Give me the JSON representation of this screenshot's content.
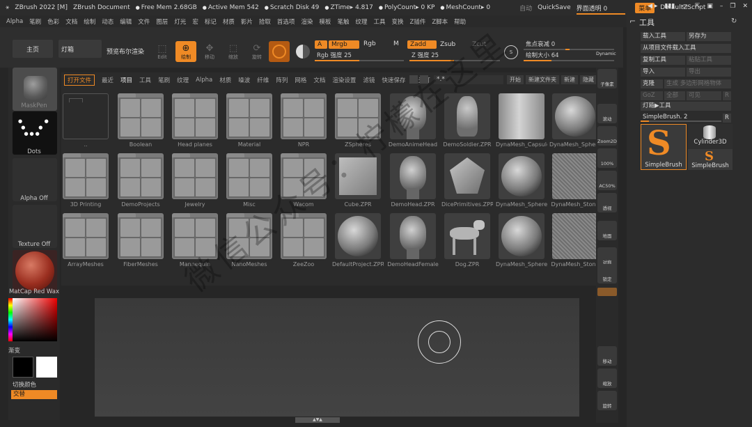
{
  "titlebar": {
    "app": "ZBrush 2022 [M]",
    "doc": "ZBrush Document",
    "free_mem": "Free Mem 2.68GB",
    "active_mem": "Active Mem 542",
    "scratch": "Scratch Disk 49",
    "ztime": "ZTime▸ 4.817",
    "polycount": "PolyCount▸ 0 KP",
    "meshcount": "MeshCount▸ 0",
    "auto": "自动",
    "quicksave": "QuickSave",
    "ui_transparency": "界面透明 0",
    "menu_btn": "菜单",
    "script": "DefaultZScript"
  },
  "menubar": [
    "Alpha",
    "笔刷",
    "色彩",
    "文档",
    "绘制",
    "动态",
    "编辑",
    "文件",
    "图层",
    "灯光",
    "宏",
    "标记",
    "材质",
    "影片",
    "拾取",
    "首选项",
    "渲染",
    "模板",
    "笔触",
    "纹理",
    "工具",
    "变换",
    "Z插件",
    "Z脚本",
    "帮助"
  ],
  "toolbar": {
    "home": "主页",
    "lightbox": "灯箱",
    "preview_bool": "预览布尔渲染",
    "edit": "Edit",
    "draw": "绘制",
    "move": "移动",
    "scale": "缩放",
    "rotate": "旋转",
    "a_btn": "A",
    "mrgb": "Mrgb",
    "rgb": "Rgb",
    "m": "M",
    "rgb_intensity": "Rgb 强度 25",
    "zadd": "Zadd",
    "zsub": "Zsub",
    "zcut": "Zcut",
    "z_intensity": "Z 强度 25",
    "focal": "焦点衰减 0",
    "draw_size": "绘制大小 64",
    "dynamic": "Dynamic"
  },
  "leftshelf": {
    "brush": "MaskPen",
    "stroke": "Dots",
    "alpha": "Alpha Off",
    "texture": "Texture Off",
    "material": "MatCap Red Wax",
    "gradient": "渐变",
    "switch_color": "切换颜色",
    "alternate": "交替"
  },
  "browser": {
    "tabs": [
      "打开文件",
      "最近",
      "项目",
      "工具",
      "笔刷",
      "纹理",
      "Alpha",
      "材质",
      "噪波",
      "纤维",
      "阵列",
      "网格",
      "文档",
      "渲染设置",
      "滤镜",
      "快速保存",
      "聚光灯"
    ],
    "search_value": "*.*",
    "right_buttons": [
      "开始",
      "新建文件夹",
      "新建",
      "隐藏"
    ],
    "items": [
      {
        "label": "..",
        "kind": "up"
      },
      {
        "label": "Boolean",
        "kind": "folder"
      },
      {
        "label": "Head planes",
        "kind": "folder"
      },
      {
        "label": "Material",
        "kind": "folder"
      },
      {
        "label": "NPR",
        "kind": "folder"
      },
      {
        "label": "ZSpheres",
        "kind": "folder"
      },
      {
        "label": "DemoAnimeHead",
        "kind": "head"
      },
      {
        "label": "DemoSoldier.ZPR",
        "kind": "body"
      },
      {
        "label": "DynaMesh_Capsule",
        "kind": "capsule"
      },
      {
        "label": "DynaMesh_Sphere",
        "kind": "sphere"
      },
      {
        "label": "3D Printing",
        "kind": "folder"
      },
      {
        "label": "DemoProjects",
        "kind": "folder"
      },
      {
        "label": "Jewelry",
        "kind": "folder"
      },
      {
        "label": "Misc",
        "kind": "folder"
      },
      {
        "label": "Wacom",
        "kind": "folder"
      },
      {
        "label": "Cube.ZPR",
        "kind": "cube"
      },
      {
        "label": "DemoHead.ZPR",
        "kind": "head"
      },
      {
        "label": "DicePrimitives.ZPR",
        "kind": "dice"
      },
      {
        "label": "DynaMesh_Sphere",
        "kind": "sphere"
      },
      {
        "label": "DynaMesh_Stone",
        "kind": "stone"
      },
      {
        "label": "ArrayMeshes",
        "kind": "folder"
      },
      {
        "label": "FiberMeshes",
        "kind": "folder"
      },
      {
        "label": "Mannequin",
        "kind": "folder"
      },
      {
        "label": "NanoMeshes",
        "kind": "folder"
      },
      {
        "label": "ZeeZoo",
        "kind": "folder"
      },
      {
        "label": "DefaultProject.ZPR",
        "kind": "sphere"
      },
      {
        "label": "DemoHeadFemale",
        "kind": "head"
      },
      {
        "label": "Dog.ZPR",
        "kind": "dog"
      },
      {
        "label": "DynaMesh_Sphere",
        "kind": "sphere"
      },
      {
        "label": "DynaMesh_Stone",
        "kind": "stone"
      }
    ]
  },
  "rbar": [
    "子像素",
    "滚动",
    "Zoom2D",
    "100%",
    "AC50%",
    "透视",
    "地面",
    "对称",
    "锁定",
    "移动",
    "缩放",
    "旋转"
  ],
  "rpanel": {
    "title": "工具",
    "load_tool": "载入工具",
    "save_as": "另存为",
    "load_from_project": "从项目文件载入工具",
    "copy_tool": "复制工具",
    "paste_tool": "粘贴工具",
    "import": "导入",
    "export": "导出",
    "clone": "克隆",
    "make_polymesh": "生成 多边形网格物体",
    "goz": "GoZ",
    "all": "全部",
    "visible": "可见",
    "r": "R",
    "lightbox_tools": "灯箱▶工具",
    "simple_brush_value": "SimpleBrush. 2",
    "tool1": "SimpleBrush",
    "tool2": "Cylinder3D",
    "tool3": "SimpleBrush"
  },
  "watermark": "微信公众号：柠檬在这里"
}
